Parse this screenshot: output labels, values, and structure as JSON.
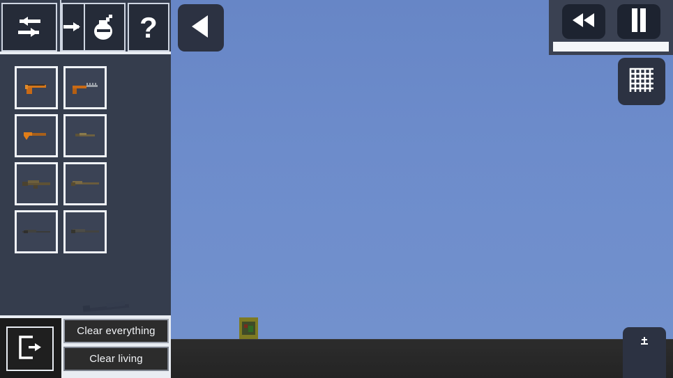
{
  "app": {
    "title": "Sandbox Weapon Spawner"
  },
  "world": {
    "sky_color": "#6d8ccb",
    "ground_color": "#2b2b2b",
    "player": {
      "name": "player-character",
      "body_color": "#7d7a22",
      "inner_color": "#3f4b28"
    }
  },
  "toolbar": {
    "buttons": [
      {
        "name": "swap-arrows-icon",
        "label": "Swap",
        "icon": "swap-arrows-icon"
      },
      {
        "name": "arrow-right-icon",
        "label": "Next",
        "icon": "arrow-right-icon"
      },
      {
        "name": "grenade-icon",
        "label": "Grenades",
        "icon": "grenade-icon"
      },
      {
        "name": "help-icon",
        "label": "Help",
        "icon": "question-mark-icon"
      }
    ]
  },
  "weapons": {
    "items": [
      {
        "name": "pistol",
        "label": "Pistol",
        "tint": "#c96a15"
      },
      {
        "name": "submachine-gun",
        "label": "Submachine Gun",
        "tint": "#c96a15"
      },
      {
        "name": "sawed-off-shotgun",
        "label": "Sawed-off Shotgun",
        "tint": "#d4761a"
      },
      {
        "name": "carbine",
        "label": "Carbine",
        "tint": "#7a6a3e"
      },
      {
        "name": "assault-rifle",
        "label": "Assault Rifle",
        "tint": "#5d5135"
      },
      {
        "name": "battle-rifle",
        "label": "Battle Rifle",
        "tint": "#6a5c3c"
      },
      {
        "name": "sniper-rifle",
        "label": "Sniper Rifle",
        "tint": "#3a3a38"
      },
      {
        "name": "marksman-rifle",
        "label": "Marksman Rifle",
        "tint": "#434340"
      }
    ]
  },
  "bottom": {
    "exit_label": "Exit",
    "clear_everything_label": "Clear everything",
    "clear_living_label": "Clear living",
    "floating_weapon_label": "Rocket Launcher"
  },
  "controls": {
    "back_label": "Back",
    "rewind_label": "Rewind",
    "pause_label": "Pause",
    "grid_label": "Toggle Grid",
    "timeline": {
      "name": "timeline-slider",
      "fill_percent": 100
    },
    "bottom_right_label": "Expand Panel"
  },
  "colors": {
    "sidebar": "#353d4d",
    "panel": "#3a4152",
    "accent": "#e9edf3",
    "button_dark": "#1d2330"
  }
}
